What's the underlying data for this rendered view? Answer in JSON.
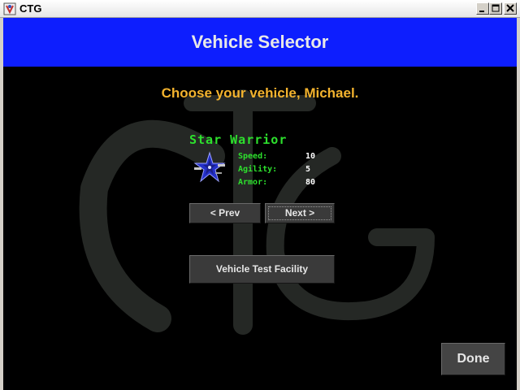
{
  "window": {
    "title": "CTG"
  },
  "header": {
    "title": "Vehicle Selector"
  },
  "prompt": "Choose your vehicle, Michael.",
  "vehicle": {
    "name": "Star Warrior",
    "stats": [
      {
        "label": "Speed:",
        "value": "10"
      },
      {
        "label": "Agility:",
        "value": "5"
      },
      {
        "label": "Armor:",
        "value": "80"
      }
    ]
  },
  "buttons": {
    "prev": "< Prev",
    "next": "Next >",
    "test_facility": "Vehicle Test Facility",
    "done": "Done"
  },
  "colors": {
    "header_bg": "#0d1efe",
    "prompt_text": "#f3b32e",
    "stat_label": "#2de02d",
    "content_bg": "#000000"
  },
  "icons": {
    "app": "app-icon",
    "vehicle": "star-warrior-ship-icon",
    "watermark": "ctg-logo-watermark"
  }
}
